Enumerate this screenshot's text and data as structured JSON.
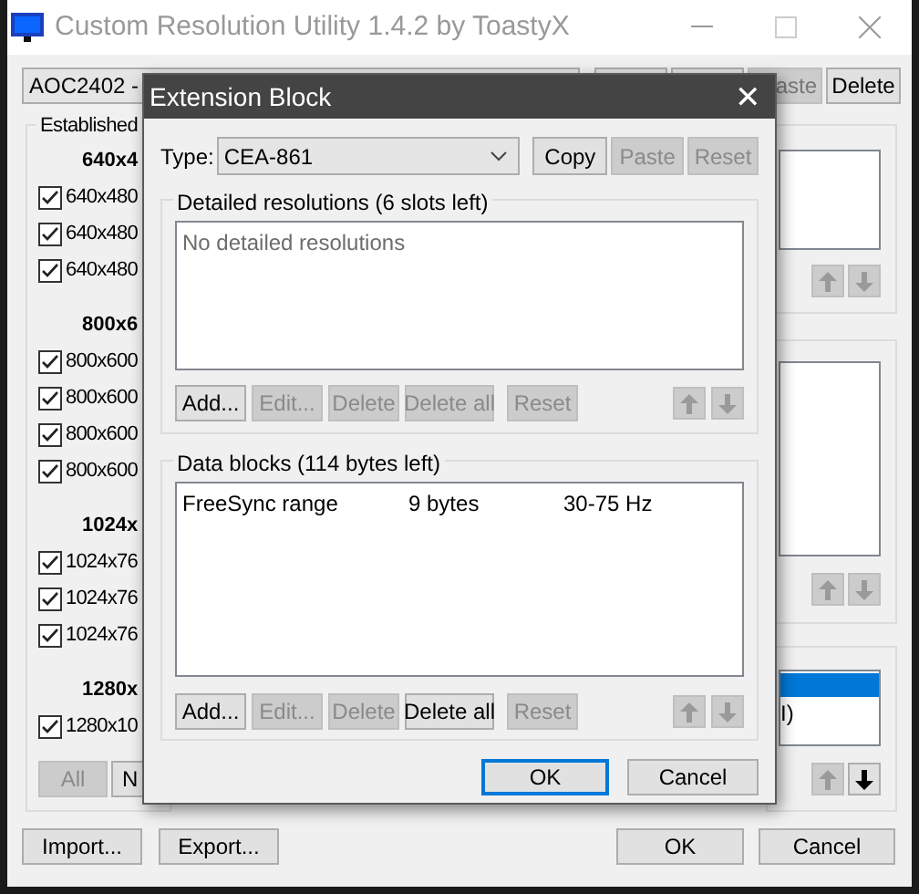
{
  "main_window": {
    "title": "Custom Resolution Utility 1.4.2 by ToastyX",
    "monitor_select": "AOC2402 -",
    "top_buttons": [
      {
        "disabled": false
      },
      {
        "disabled": false
      },
      {
        "label": "aste",
        "disabled": true
      },
      {
        "label": "Delete",
        "disabled": false
      }
    ],
    "established": {
      "title": "Established",
      "sections": [
        {
          "heading": "640x4",
          "items": [
            {
              "label": "640x480",
              "checked": true
            },
            {
              "label": "640x480",
              "checked": true
            },
            {
              "label": "640x480",
              "checked": true
            }
          ]
        },
        {
          "heading": "800x6",
          "items": [
            {
              "label": "800x600",
              "checked": true
            },
            {
              "label": "800x600",
              "checked": true
            },
            {
              "label": "800x600",
              "checked": true
            },
            {
              "label": "800x600",
              "checked": true
            }
          ]
        },
        {
          "heading": "1024x",
          "items": [
            {
              "label": "1024x76",
              "checked": true
            },
            {
              "label": "1024x76",
              "checked": true
            },
            {
              "label": "1024x76",
              "checked": true
            }
          ]
        },
        {
          "heading": "1280x",
          "items": [
            {
              "label": "1280x10",
              "checked": true
            }
          ]
        }
      ],
      "buttons": [
        {
          "label": "All",
          "disabled": true
        },
        {
          "label": "N",
          "disabled": false
        }
      ]
    },
    "right_groups": [
      {
        "arrows": [
          {
            "kind": "up",
            "disabled": true
          },
          {
            "kind": "down",
            "disabled": true
          }
        ]
      },
      {
        "arrows": [
          {
            "kind": "up",
            "disabled": true
          },
          {
            "kind": "down",
            "disabled": true
          }
        ]
      },
      {
        "rows": [
          {
            "selected": true
          },
          {
            "text": "I)",
            "selected": false
          }
        ],
        "arrows": [
          {
            "kind": "up",
            "disabled": true
          },
          {
            "kind": "down",
            "disabled": false
          }
        ]
      }
    ],
    "bottom_buttons": [
      {
        "label": "Import...",
        "disabled": false
      },
      {
        "label": "Export...",
        "disabled": false
      },
      {
        "label": "OK",
        "disabled": false
      },
      {
        "label": "Cancel",
        "disabled": false
      }
    ]
  },
  "dialog": {
    "title": "Extension Block",
    "close": "✕",
    "type_label": "Type:",
    "type_value": "CEA-861",
    "type_buttons": [
      {
        "label": "Copy",
        "disabled": false
      },
      {
        "label": "Paste",
        "disabled": true
      },
      {
        "label": "Reset",
        "disabled": true
      }
    ],
    "groups": [
      {
        "title": "Detailed resolutions (6 slots left)",
        "empty_text": "No detailed resolutions",
        "buttons": [
          {
            "label": "Add...",
            "disabled": false
          },
          {
            "label": "Edit...",
            "disabled": true
          },
          {
            "label": "Delete",
            "disabled": true
          },
          {
            "label": "Delete all",
            "disabled": true
          },
          {
            "label": "Reset",
            "disabled": true
          }
        ],
        "arrows": [
          {
            "kind": "up",
            "disabled": true
          },
          {
            "kind": "down",
            "disabled": true
          }
        ]
      },
      {
        "title": "Data blocks (114 bytes left)",
        "rows": [
          {
            "name": "FreeSync range",
            "size": "9 bytes",
            "value": "30-75 Hz"
          }
        ],
        "buttons": [
          {
            "label": "Add...",
            "disabled": false
          },
          {
            "label": "Edit...",
            "disabled": true
          },
          {
            "label": "Delete",
            "disabled": true
          },
          {
            "label": "Delete all",
            "disabled": false
          },
          {
            "label": "Reset",
            "disabled": true
          }
        ],
        "arrows": [
          {
            "kind": "up",
            "disabled": true
          },
          {
            "kind": "down",
            "disabled": true
          }
        ]
      }
    ],
    "footer_buttons": [
      {
        "label": "OK",
        "default": true
      },
      {
        "label": "Cancel",
        "default": false
      }
    ]
  }
}
